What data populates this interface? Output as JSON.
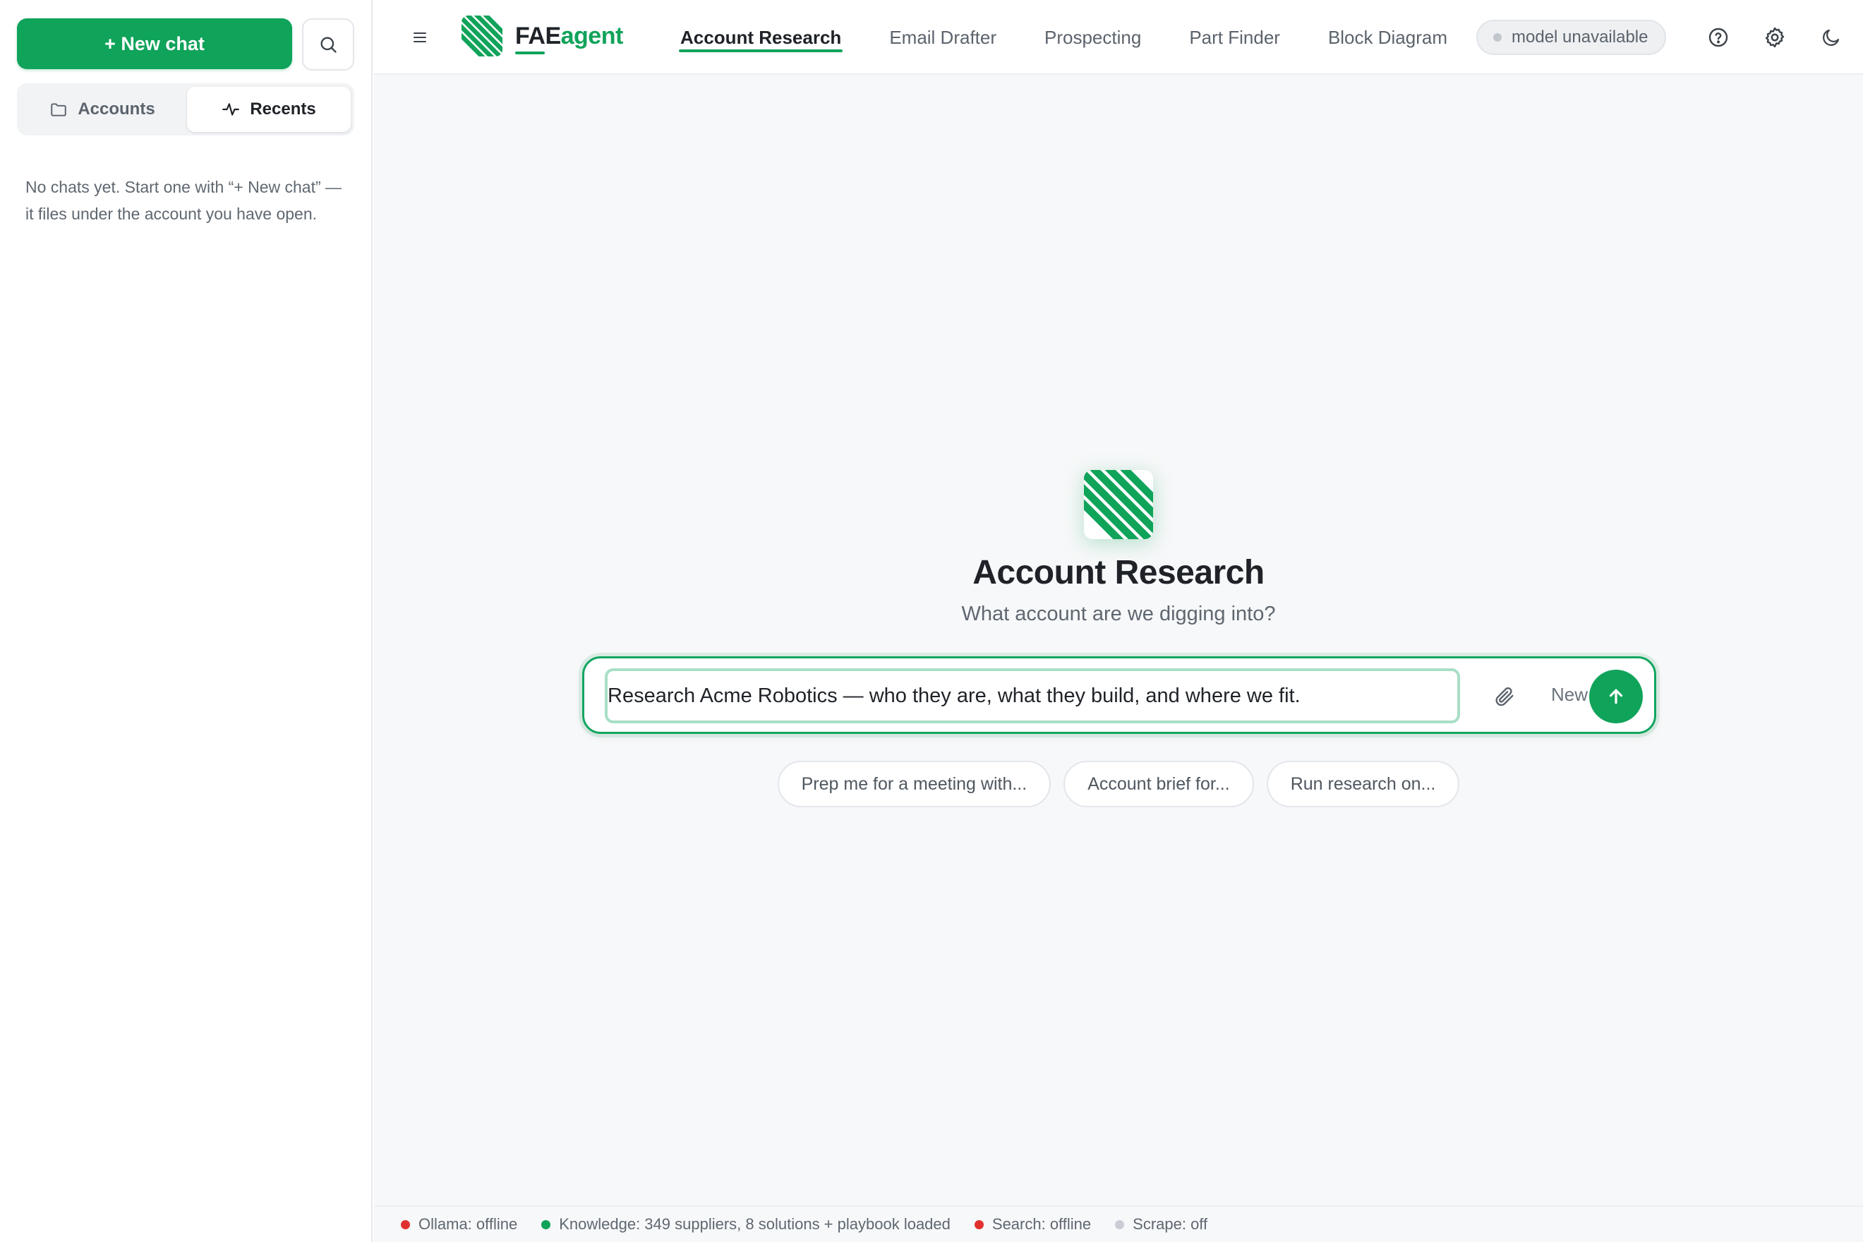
{
  "sidebar": {
    "new_chat_label": "+ New chat",
    "segments": [
      {
        "label": "Accounts",
        "icon": "folder-icon",
        "active": false
      },
      {
        "label": "Recents",
        "icon": "activity-icon",
        "active": true
      }
    ],
    "empty_message": "No chats yet. Start one with “+ New chat” — it files under the account you have open."
  },
  "header": {
    "brand_prefix": "FAE",
    "brand_suffix": "agent",
    "tabs": [
      {
        "label": "Account Research",
        "active": true
      },
      {
        "label": "Email Drafter",
        "active": false
      },
      {
        "label": "Prospecting",
        "active": false
      },
      {
        "label": "Part Finder",
        "active": false
      },
      {
        "label": "Block Diagram",
        "active": false
      }
    ],
    "model_status": "model unavailable",
    "icons": [
      "help-icon",
      "settings-gear-icon",
      "dark-mode-moon-icon"
    ]
  },
  "main": {
    "title": "Account Research",
    "subtitle": "What account are we digging into?",
    "composer": {
      "value": "Research Acme Robotics — who they are, what they build, and where we fit.",
      "mode_label": "New"
    },
    "suggestions": [
      "Prep me for a meeting with...",
      "Account brief for...",
      "Run research on..."
    ]
  },
  "status_bar": {
    "items": [
      {
        "label": "Ollama: offline",
        "color": "#e0312f"
      },
      {
        "label": "Knowledge: 349 suppliers, 8 solutions + playbook loaded",
        "color": "#10a35a"
      },
      {
        "label": "Search: offline",
        "color": "#e0312f"
      },
      {
        "label": "Scrape: off",
        "color": "#c9ced4"
      }
    ]
  },
  "colors": {
    "accent": "#10a35a",
    "offline": "#e0312f",
    "muted": "#c9ced4"
  }
}
